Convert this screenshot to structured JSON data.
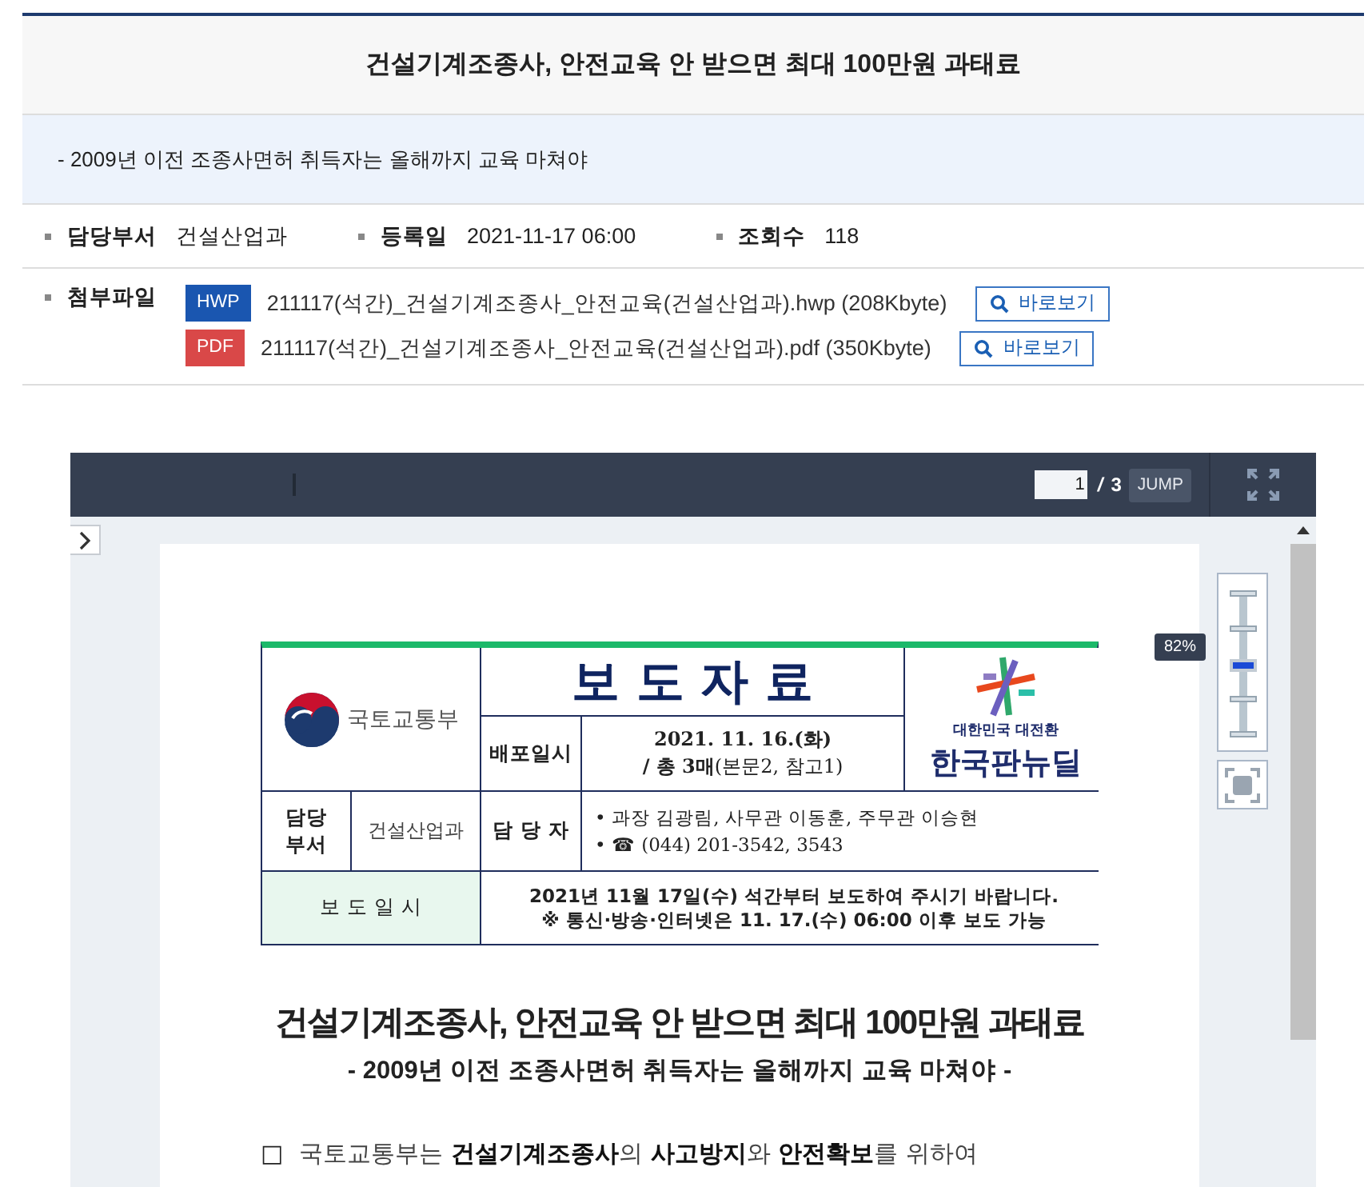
{
  "article": {
    "title": "건설기계조종사, 안전교육 안 받으면 최대 100만원 과태료",
    "summary": "-  2009년 이전 조종사면허 취득자는 올해까지 교육 마쳐야",
    "meta": [
      {
        "label": "담당부서",
        "value": "건설산업과"
      },
      {
        "label": "등록일",
        "value": "2021-11-17 06:00"
      },
      {
        "label": "조회수",
        "value": "118"
      }
    ],
    "attachments_label": "첨부파일",
    "attachments": [
      {
        "kind": "hwp",
        "badge": "HWP",
        "file": "211117(석간)_건설기계조종사_안전교육(건설산업과).hwp (208Kbyte)",
        "button": "바로보기"
      },
      {
        "kind": "pdf",
        "badge": "PDF",
        "file": "211117(석간)_건설기계조종사_안전교육(건설산업과).pdf (350Kbyte)",
        "button": "바로보기"
      }
    ]
  },
  "viewer": {
    "page": "1",
    "separator": "/",
    "total": "3",
    "jump": "JUMP",
    "zoom_label": "82%",
    "zoom": {
      "level": 0.5
    },
    "document": {
      "ministry": "국토교통부",
      "title": "보 도 자 료",
      "release_label": "배포일시",
      "release_date": "2021. 11. 16.(화)",
      "release_pages": "**/ 총 3매**(본문2, 참고1)",
      "slogan_small": "대한민국 대전환",
      "slogan": "한국판뉴딜",
      "dept_label": "담당 부서",
      "dept": "건설산업과",
      "contact_label": "담 당 자",
      "contacts": [
        "• 과장 김광림, 사무관 이동훈, 주무관 이승현",
        "• ☎ (044) 201-3542, 3543"
      ],
      "embargo_label": "보 도 일 시",
      "embargo": [
        "2021년 11월 17일(수) 석간부터 보도하여 주시기 바랍니다.",
        "※ 통신·방송·인터넷은 11. 17.(수) 06:00 이후 보도 가능"
      ],
      "headline": "건설기계조종사, 안전교육 안 받으면 최대 100만원 과태료",
      "subheadline": "- 2009년 이전 조종사면허 취득자는 올해까지 교육 마쳐야 -",
      "paragraphs": [
        {
          "bullet": "□",
          "text": "국토교통부는 **건설기계조종사**의 **사고방지**와 **안전확보**를 위하여"
        }
      ]
    }
  }
}
